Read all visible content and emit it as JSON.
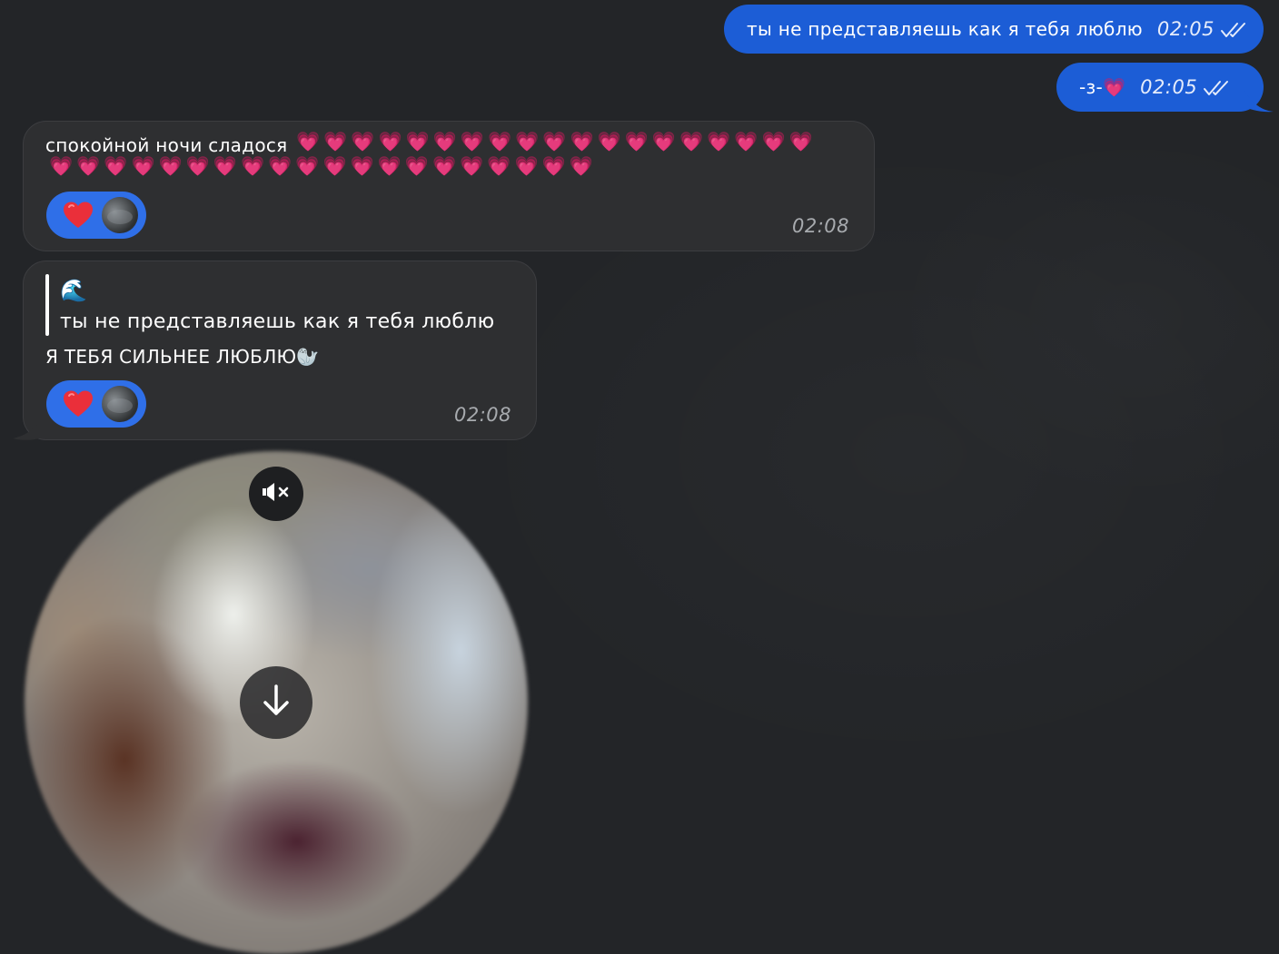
{
  "messages": {
    "out1": {
      "text": "ты не представляешь как я тебя люблю",
      "time": "02:05",
      "status": "read"
    },
    "out2": {
      "text": "-з-💗",
      "time": "02:05",
      "status": "read"
    },
    "in1": {
      "text": "спокойной ночи сладося",
      "hearts_line1": "💗💗💗💗💗💗💗💗💗💗💗💗💗💗💗💗💗💗💗",
      "hearts_line2": "💗💗💗💗💗💗💗💗💗💗💗💗💗💗💗💗💗💗💗💗",
      "reaction": "❤️",
      "time": "02:08"
    },
    "in2": {
      "reply_emoji": "🌊",
      "reply_text": "ты не представляешь как я тебя люблю",
      "text": "Я ТЕБЯ СИЛЬНЕЕ ЛЮБЛЮ🦭",
      "reaction": "❤️",
      "time": "02:08"
    }
  },
  "video_message": {
    "mute_icon": "speaker-muted-icon",
    "download_icon": "arrow-down-icon"
  },
  "colors": {
    "background": "#232528",
    "outgoing_bubble": "#1c5dd6",
    "incoming_bubble": "#2e2f31",
    "reaction_pill": "#2f6fe8",
    "heart": "#e8559b"
  }
}
